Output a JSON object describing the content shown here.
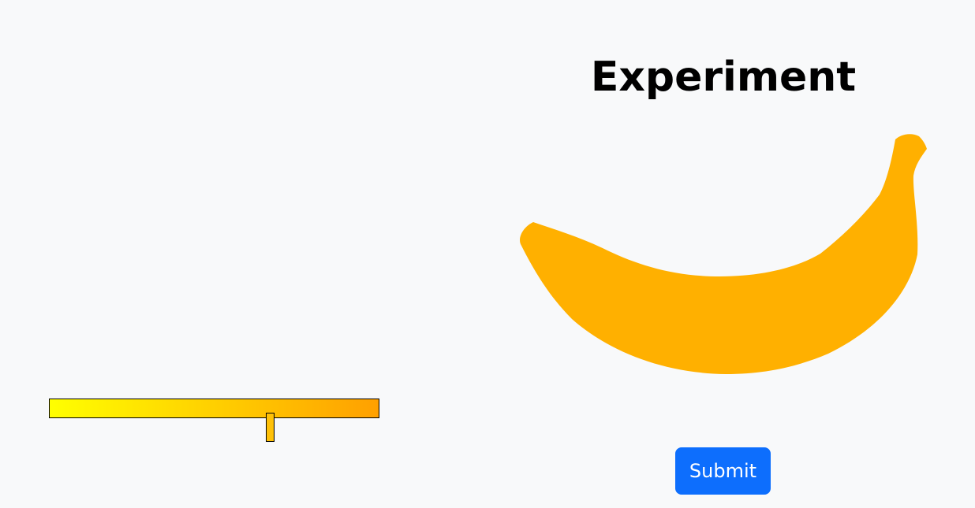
{
  "page": {
    "title": "Experiment"
  },
  "colors": {
    "page_background": "#f8f9fa",
    "banana_fill": "#ffb000",
    "gradient_start": "#ffff00",
    "gradient_end": "#ffa000",
    "handle_fill": "#ffc107",
    "submit_background": "#0d6efd"
  },
  "slider": {
    "value": 0.67
  },
  "submit": {
    "label": "Submit"
  }
}
